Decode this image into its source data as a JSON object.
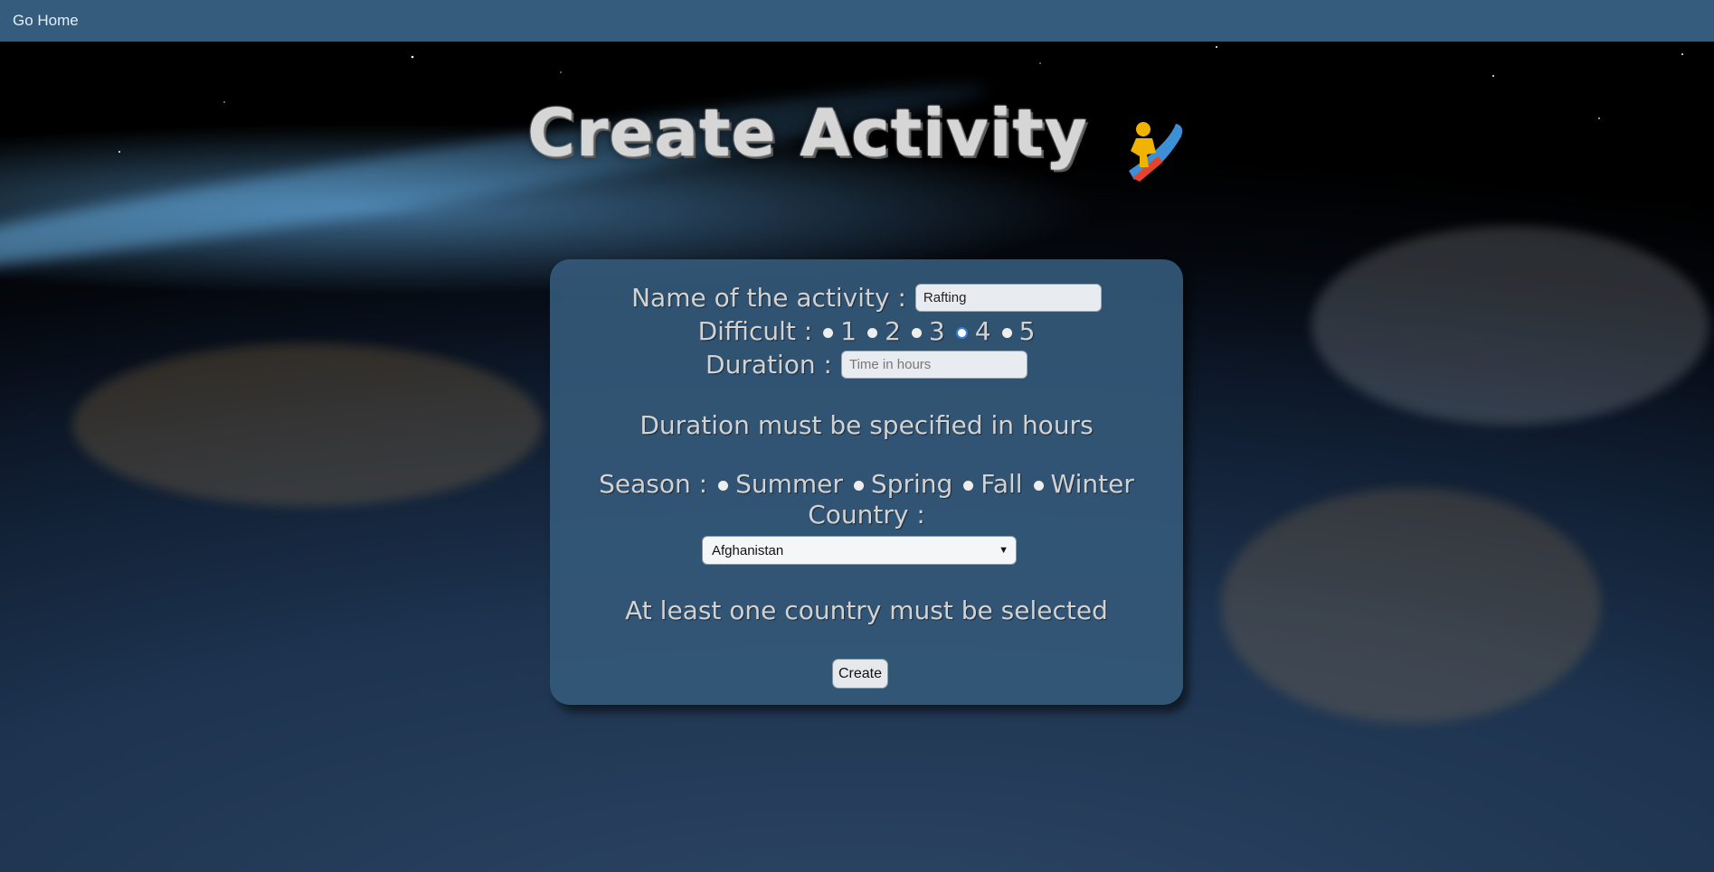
{
  "nav": {
    "home_label": "Go Home"
  },
  "page": {
    "title": "Create Activity"
  },
  "form": {
    "name_label": "Name of the activity :",
    "name_value": "Rafting",
    "difficulty_label": "Difficult :",
    "difficulty_options": [
      "1",
      "2",
      "3",
      "4",
      "5"
    ],
    "difficulty_selected": "4",
    "duration_label": "Duration :",
    "duration_placeholder": "Time in hours",
    "duration_error": "Duration must be specified in hours",
    "season_label": "Season :",
    "season_options": [
      "Summer",
      "Spring",
      "Fall",
      "Winter"
    ],
    "country_label": "Country :",
    "country_selected": "Afghanistan",
    "country_error": "At least one country must be selected",
    "create_label": "Create"
  },
  "colors": {
    "topbar": "#355c7d",
    "card": "#345878",
    "radio_selected_ring": "#3b7bd9"
  },
  "icons": {
    "title_emoji": "person-surfing-icon"
  }
}
